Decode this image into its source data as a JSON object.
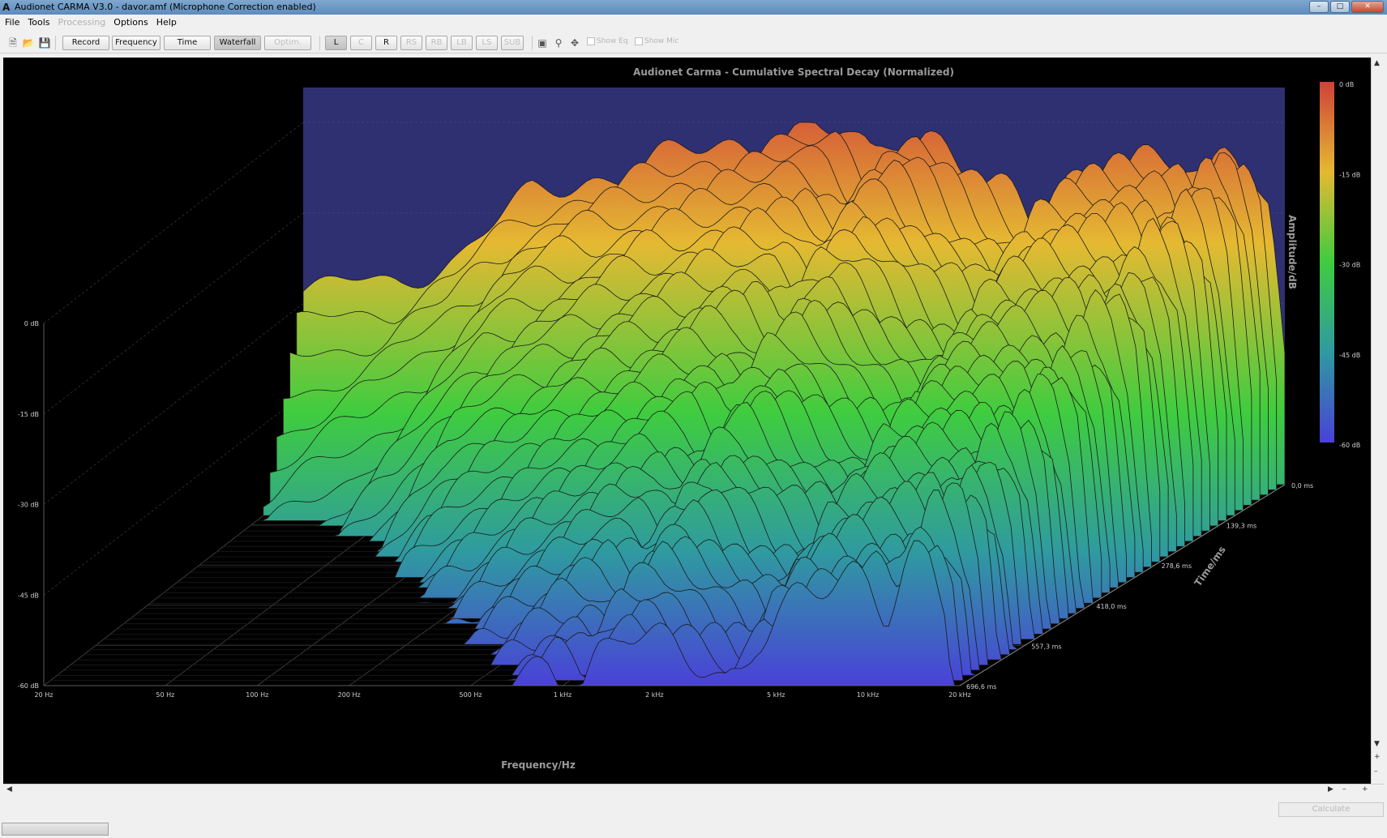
{
  "window": {
    "title": "Audionet CARMA V3.0 - davor.amf (Microphone Correction enabled)",
    "app_icon": "A",
    "min_label": "–",
    "max_label": "□",
    "close_label": "✕"
  },
  "menu": {
    "file": "File",
    "tools": "Tools",
    "processing": "Processing",
    "options": "Options",
    "help": "Help"
  },
  "toolbar": {
    "record": "Record",
    "frequency": "Frequency",
    "time": "Time",
    "waterfall": "Waterfall",
    "optimize": "Optim.",
    "channels": [
      "L",
      "C",
      "R",
      "RS",
      "RB",
      "LB",
      "LS",
      "SUB"
    ],
    "show_eq": "Show Eq",
    "show_mic": "Show Mic",
    "icons": [
      "new-file-icon",
      "open-folder-icon",
      "save-icon",
      "window-icon",
      "zoom-icon",
      "pan-icon"
    ]
  },
  "chart_data": {
    "type": "waterfall",
    "title": "Audionet Carma - Cumulative Spectral Decay (Normalized)",
    "xlabel": "Frequency/Hz",
    "ylabel": "Amplitude/dB",
    "zlabel": "Time/ms",
    "x_scale": "log",
    "x_range_hz": [
      20,
      20000
    ],
    "x_ticks": [
      "20 Hz",
      "50 Hz",
      "100 Hz",
      "200 Hz",
      "500 Hz",
      "1 kHz",
      "2 kHz",
      "5 kHz",
      "10 kHz",
      "20 kHz"
    ],
    "x_tick_values": [
      20,
      50,
      100,
      200,
      500,
      1000,
      2000,
      5000,
      10000,
      20000
    ],
    "y_ticks": [
      "0 dB",
      "-15 dB",
      "-30 dB",
      "-45 dB",
      "-60 dB"
    ],
    "y_range_db": [
      -60,
      0
    ],
    "time_ticks": [
      "0,0 ms",
      "139,3 ms",
      "278,6 ms",
      "418,0 ms",
      "557,3 ms",
      "696,6 ms"
    ],
    "time_range_ms": [
      0,
      696.6
    ],
    "colorbar_labels": [
      "0 dB",
      "-15 dB",
      "-30 dB",
      "-45 dB",
      "-60 dB"
    ],
    "colorscale": [
      "#d0413a",
      "#e5b932",
      "#3fcc3f",
      "#2f9aa0",
      "#4a41d8"
    ],
    "slice_count": 40,
    "front_slice_db": [
      [
        20,
        -28
      ],
      [
        40,
        -26
      ],
      [
        60,
        -22
      ],
      [
        100,
        -12
      ],
      [
        150,
        -9
      ],
      [
        200,
        -8
      ],
      [
        300,
        -5
      ],
      [
        400,
        -4
      ],
      [
        500,
        -3
      ],
      [
        700,
        -1
      ],
      [
        900,
        -2
      ],
      [
        1100,
        -7
      ],
      [
        1300,
        -2
      ],
      [
        1600,
        -1
      ],
      [
        1800,
        -3
      ],
      [
        2200,
        -8
      ],
      [
        2500,
        -11
      ],
      [
        3000,
        -14
      ],
      [
        3400,
        -17
      ],
      [
        3800,
        -15
      ],
      [
        4300,
        -10
      ],
      [
        5000,
        -8
      ],
      [
        6000,
        -7
      ],
      [
        7500,
        -7
      ],
      [
        9000,
        -7
      ],
      [
        10000,
        -8
      ],
      [
        11500,
        -12
      ],
      [
        13000,
        -5
      ],
      [
        14000,
        -3
      ],
      [
        16000,
        -6
      ],
      [
        18000,
        -14
      ],
      [
        20000,
        -40
      ]
    ]
  },
  "status": {
    "calculate": "Calculate"
  }
}
